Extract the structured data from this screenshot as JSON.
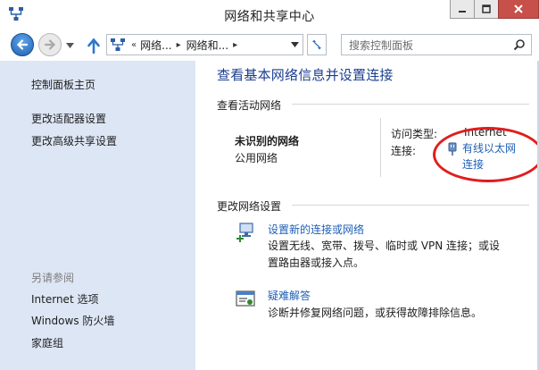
{
  "window": {
    "title": "网络和共享中心"
  },
  "address_bar": {
    "crumb_prefix": "«",
    "crumbs": [
      "网络...",
      "网络和..."
    ],
    "crumb_separator": "▸"
  },
  "search": {
    "placeholder": "搜索控制面板"
  },
  "left_pane": {
    "links": [
      "控制面板主页",
      "更改适配器设置",
      "更改高级共享设置"
    ],
    "see_also_heading": "另请参阅",
    "see_also": [
      "Internet 选项",
      "Windows 防火墙",
      "家庭组"
    ]
  },
  "main": {
    "title": "查看基本网络信息并设置连接",
    "active_networks_label": "查看活动网络",
    "network": {
      "name": "未识别的网络",
      "type": "公用网络",
      "access_type_label": "访问类型:",
      "access_type_value": "Internet",
      "connections_label": "连接:",
      "connection_line1": "有线以太网",
      "connection_line2": "连接"
    },
    "change_settings_label": "更改网络设置",
    "tasks": [
      {
        "title": "设置新的连接或网络",
        "desc_line1": "设置无线、宽带、拨号、临时或 VPN 连接；或设",
        "desc_line2": "置路由器或接入点。"
      },
      {
        "title": "疑难解答",
        "desc_line1": "诊断并修复网络问题，或获得故障排除信息。"
      }
    ]
  },
  "colors": {
    "link": "#1f5fb5",
    "title": "#1c3e8f",
    "left_pane_bg": "#dde6f5",
    "annotation": "#e11d1d",
    "close_button": "#c7504a"
  },
  "icons": {
    "app": "network-icon",
    "back": "back-arrow-icon",
    "forward": "forward-arrow-icon",
    "up": "up-arrow-icon",
    "refresh": "refresh-icon",
    "search": "search-icon",
    "ethernet": "ethernet-plug-icon",
    "new_connection": "new-connection-icon",
    "troubleshoot": "troubleshoot-icon"
  }
}
